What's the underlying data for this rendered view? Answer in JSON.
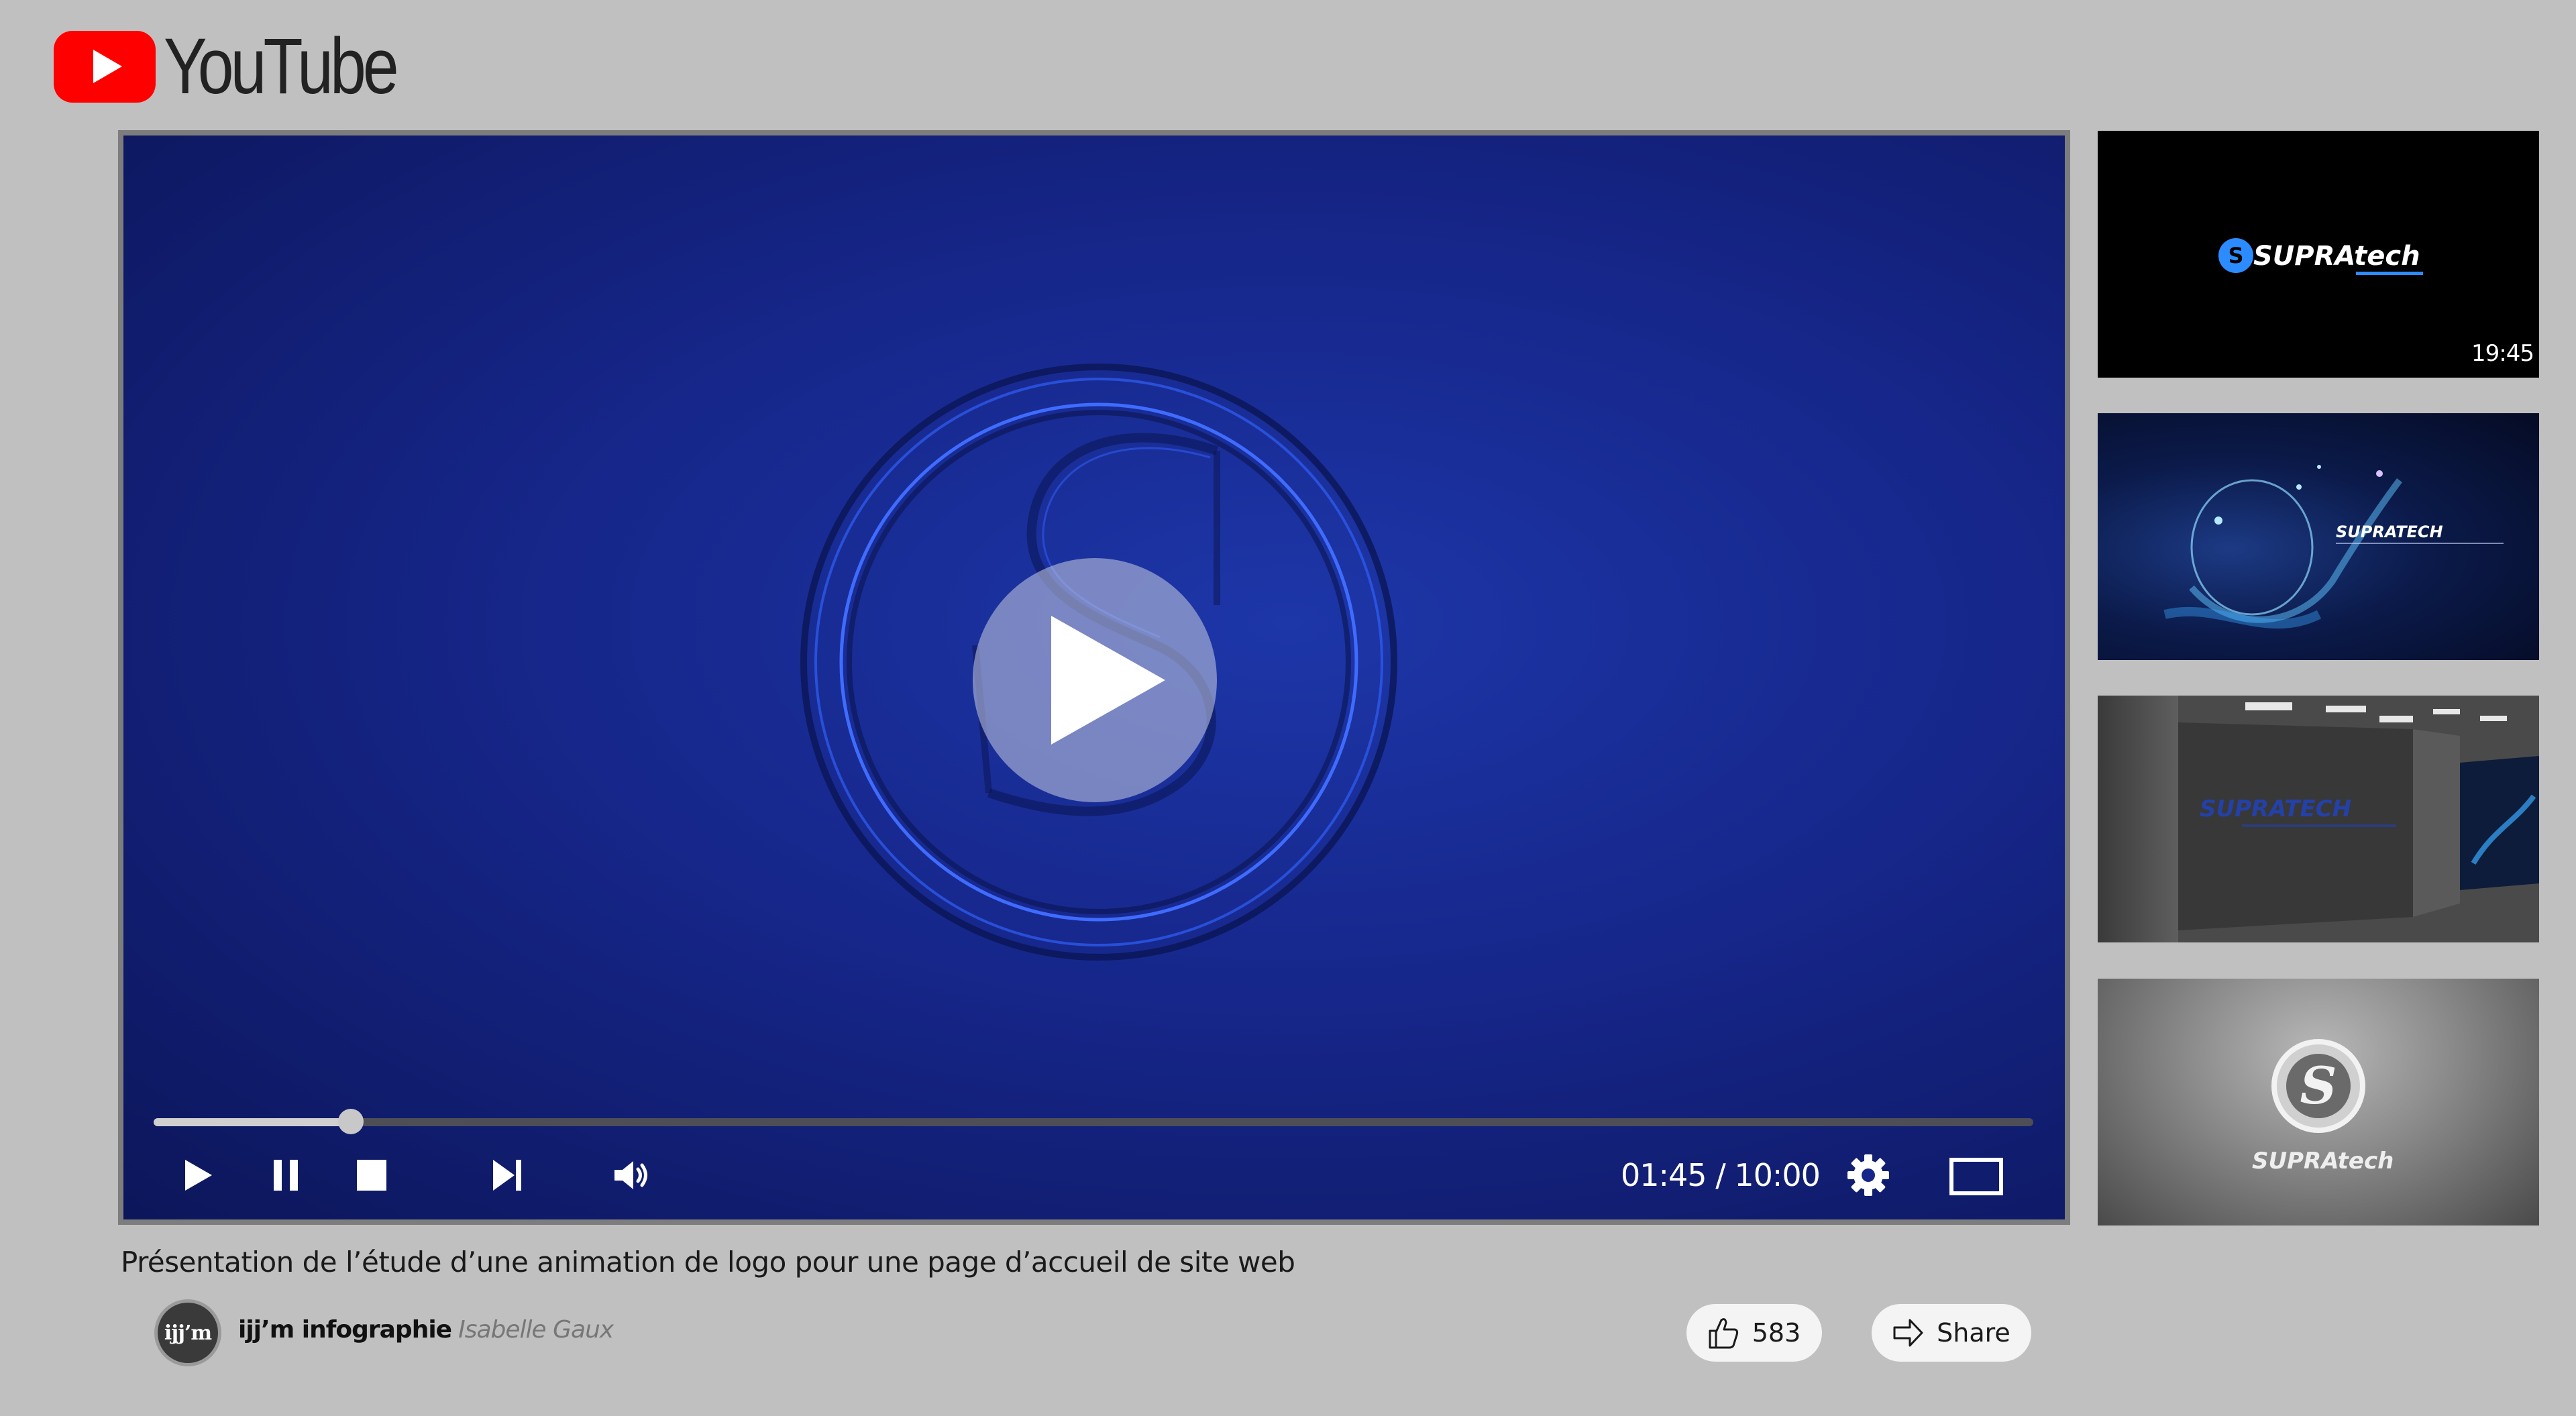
{
  "brand": {
    "name": "YouTube",
    "accent": "#ff0000"
  },
  "player": {
    "time_current": "01:45",
    "time_total": "10:00",
    "progress_fraction": 0.105,
    "icons": [
      "play-icon",
      "pause-icon",
      "stop-icon",
      "skip-next-icon",
      "volume-icon",
      "settings-gear-icon",
      "theater-mode-icon"
    ]
  },
  "video": {
    "title": "Présentation de l’étude d’une animation de logo pour une page d’accueil de site web",
    "channel_name": "ijj’m infographie",
    "channel_author": "Isabelle Gaux",
    "channel_avatar_text": "ijj’m",
    "likes": "583",
    "share_label": "Share"
  },
  "sidebar": {
    "thumbnails": [
      {
        "logo_text": "SUPRAtech",
        "duration": "19:45"
      },
      {
        "logo_text": "SUPRATECH",
        "duration": ""
      },
      {
        "logo_text": "SUPRATECH",
        "duration": ""
      },
      {
        "logo_text": "SUPRAtech",
        "duration": ""
      }
    ]
  }
}
